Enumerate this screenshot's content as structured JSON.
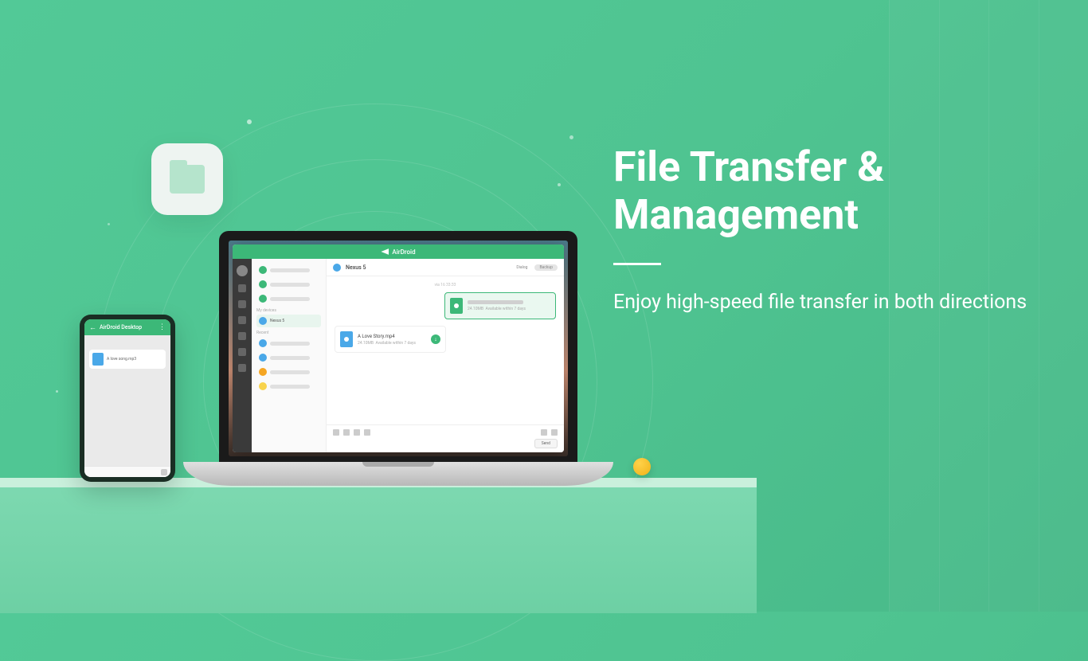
{
  "hero": {
    "title": "File Transfer & Management",
    "subtitle": "Enjoy high-speed file transfer in both directions"
  },
  "app": {
    "name": "AirDroid",
    "chat_header": {
      "device": "Nexus 5",
      "tab_dialog": "Dialog",
      "tab_backup": "Backup"
    },
    "chat_date": "via 16 33:33",
    "sent_msg": {
      "size": "24.10MB",
      "availability": "Available within 7 days"
    },
    "received_msg": {
      "filename": "A Love Story.mp4",
      "size": "24.10MB",
      "availability": "Available within 7 days"
    },
    "send_button": "Send",
    "list_sections": {
      "my_devices": "My devices",
      "recent": "Recent"
    },
    "list_device": "Nexus 5"
  },
  "phone": {
    "title": "AirDroid Desktop",
    "filename": "A love song.mp3"
  }
}
